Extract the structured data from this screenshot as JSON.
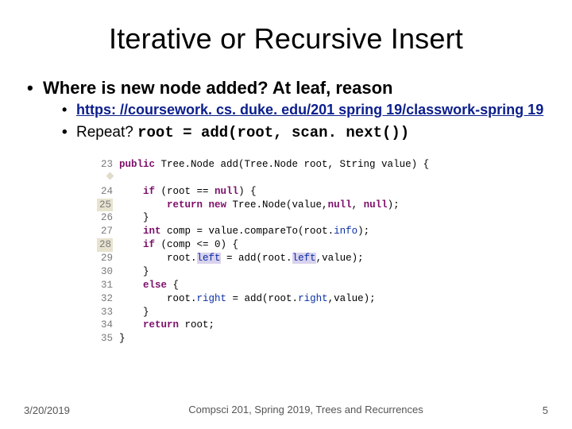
{
  "title": "Iterative or Recursive Insert",
  "bullets": {
    "main": "Where is new node added? At leaf, reason",
    "link_text": "https: //coursework. cs. duke. edu/201 spring 19/classwork-spring 19",
    "repeat_prefix": "Repeat? ",
    "repeat_code": "root = add(root, scan. next())"
  },
  "code": {
    "gutter": [
      "23",
      "24",
      "25",
      "26",
      "27",
      "28",
      "29",
      "30",
      "31",
      "32",
      "33",
      "34",
      "35"
    ],
    "highlight_lines": [
      25,
      28
    ],
    "diamond_line": 23,
    "lines": {
      "23": {
        "indent": 0,
        "segments": [
          {
            "t": "public ",
            "c": "kw"
          },
          {
            "t": "Tree.Node add(Tree.Node root, String value) {"
          }
        ]
      },
      "24": {
        "indent": 1,
        "segments": [
          {
            "t": "if",
            "c": "bkw"
          },
          {
            "t": " (root == "
          },
          {
            "t": "null",
            "c": "nul"
          },
          {
            "t": ") {"
          }
        ]
      },
      "25": {
        "indent": 2,
        "segments": [
          {
            "t": "return new",
            "c": "bkw"
          },
          {
            "t": " Tree.Node(value,"
          },
          {
            "t": "null",
            "c": "nul"
          },
          {
            "t": ", "
          },
          {
            "t": "null",
            "c": "nul"
          },
          {
            "t": ");"
          }
        ]
      },
      "26": {
        "indent": 1,
        "segments": [
          {
            "t": "}"
          }
        ]
      },
      "27": {
        "indent": 1,
        "segments": [
          {
            "t": "int",
            "c": "bkw"
          },
          {
            "t": " comp = value.compareTo(root."
          },
          {
            "t": "info",
            "c": "fld"
          },
          {
            "t": ");"
          }
        ]
      },
      "28": {
        "indent": 1,
        "segments": [
          {
            "t": "if",
            "c": "bkw"
          },
          {
            "t": " (comp <= 0) {"
          }
        ]
      },
      "29": {
        "indent": 2,
        "segments": [
          {
            "t": "root."
          },
          {
            "t": "left",
            "c": "fld sel"
          },
          {
            "t": " = add(root."
          },
          {
            "t": "left",
            "c": "fld sel"
          },
          {
            "t": ",value);"
          }
        ]
      },
      "30": {
        "indent": 1,
        "segments": [
          {
            "t": "}"
          }
        ]
      },
      "31": {
        "indent": 1,
        "segments": [
          {
            "t": "else",
            "c": "bkw"
          },
          {
            "t": " {"
          }
        ]
      },
      "32": {
        "indent": 2,
        "segments": [
          {
            "t": "root."
          },
          {
            "t": "right",
            "c": "fld"
          },
          {
            "t": " = add(root."
          },
          {
            "t": "right",
            "c": "fld"
          },
          {
            "t": ",value);"
          }
        ]
      },
      "33": {
        "indent": 1,
        "segments": [
          {
            "t": "}"
          }
        ]
      },
      "34": {
        "indent": 1,
        "segments": [
          {
            "t": "return",
            "c": "bkw"
          },
          {
            "t": " root;"
          }
        ]
      },
      "35": {
        "indent": 0,
        "segments": [
          {
            "t": "}"
          }
        ]
      }
    }
  },
  "footer": {
    "date": "3/20/2019",
    "center": "Compsci 201, Spring 2019,  Trees and Recurrences",
    "page": "5"
  }
}
